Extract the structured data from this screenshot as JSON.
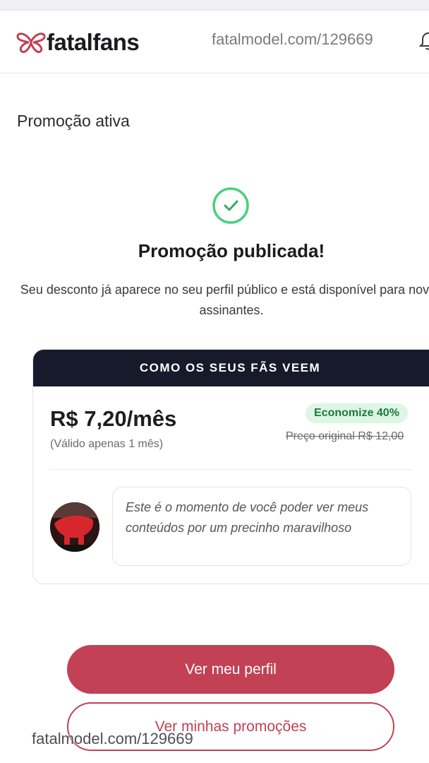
{
  "header": {
    "brand": "fatalfans",
    "url": "fatalmodel.com/129669"
  },
  "section_title": "Promoção ativa",
  "success": {
    "title": "Promoção publicada!",
    "description": "Seu desconto já aparece no seu perfil público e está disponível para novos assinantes."
  },
  "card": {
    "header": "COMO OS SEUS FÃS VEEM",
    "price": "R$ 7,20/mês",
    "validity": "(Válido apenas 1 mês)",
    "badge": "Economize 40%",
    "original_price": "Preço original R$ 12,00",
    "message": "Este é o momento de você poder ver meus conteúdos por um precinho maravilhoso"
  },
  "buttons": {
    "primary": "Ver meu perfil",
    "secondary": "Ver minhas promoções"
  },
  "watermark": "fatalmodel.com/129669",
  "colors": {
    "accent": "#c24155",
    "card_header_bg": "#161a2b",
    "badge_bg": "#def6e4",
    "badge_text": "#1e7a38",
    "success_green": "#4cd07d"
  },
  "icons": {
    "logo": "butterfly-logo-icon",
    "bell": "bell-icon",
    "success": "check-circle-icon"
  }
}
